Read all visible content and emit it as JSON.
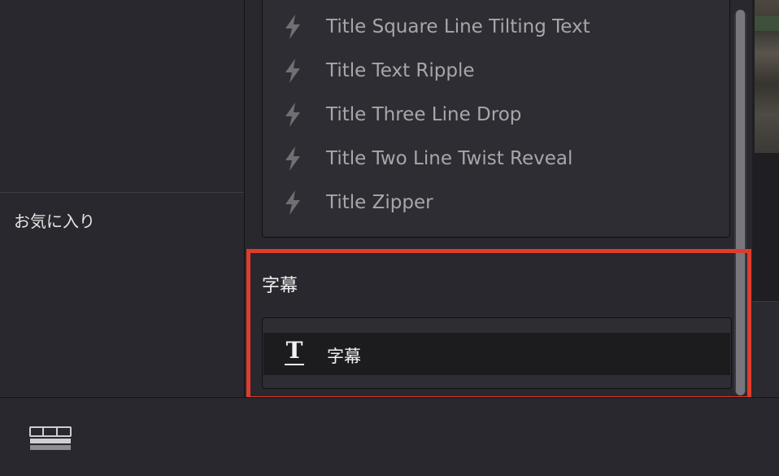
{
  "favorites": {
    "label": "お気に入り"
  },
  "effects": [
    {
      "label": "Title Square Line Tilting Text",
      "icon": "lightning-icon"
    },
    {
      "label": "Title Text Ripple",
      "icon": "lightning-icon"
    },
    {
      "label": "Title Three Line Drop",
      "icon": "lightning-icon"
    },
    {
      "label": "Title Two Line Twist Reveal",
      "icon": "lightning-icon"
    },
    {
      "label": "Title Zipper",
      "icon": "lightning-icon"
    }
  ],
  "subtitles": {
    "header": "字幕",
    "items": [
      {
        "label": "字幕",
        "icon": "text-title-icon"
      }
    ]
  },
  "colors": {
    "highlight": "#e03c2c",
    "panel": "#28282e",
    "list_bg": "#2d2d33",
    "text_dim": "#a7a7ab"
  }
}
